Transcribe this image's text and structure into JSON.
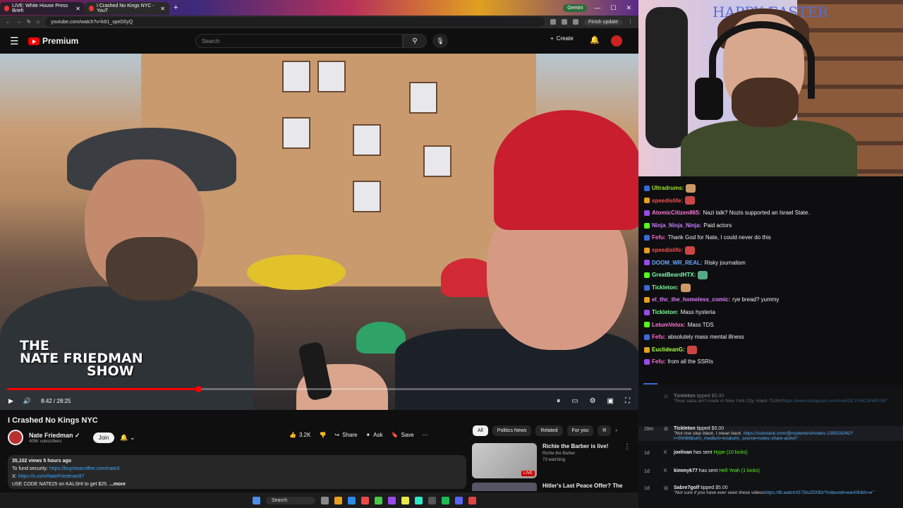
{
  "browser": {
    "tabs": [
      {
        "title": "LIVE: White House Press Briefi",
        "active": false
      },
      {
        "title": "I Crashed No Kings NYC - YouT",
        "active": true
      }
    ],
    "gemini_label": "Gemini",
    "url": "youtube.com/watch?v=k61_speD0yQ",
    "finish_update": "Finish update"
  },
  "youtube": {
    "brand": "Premium",
    "search_placeholder": "Search",
    "create_label": "Create"
  },
  "video": {
    "overlay_line1": "THE",
    "overlay_line2": "NATE FRIEDMAN",
    "overlay_line3": "SHOW",
    "time": "8:42 / 28:25",
    "progress": 0.306,
    "title": "I Crashed No Kings NYC",
    "channel": "Nate Friedman",
    "subscribers": "405K subscribers",
    "join_label": "Join",
    "likes": "3.2K",
    "share_label": "Share",
    "ask_label": "Ask",
    "save_label": "Save",
    "description": {
      "meta": "35,102 views  5 hours ago",
      "line1_prefix": "To fund security: ",
      "line1_link": "https://buymeacoffee.com/nate3",
      "line2_prefix": "X: ",
      "line2_link": "https://x.com/NateFriedman97",
      "line3": "USE CODE NATE25 on KALSHI to get $25. ",
      "more": "...more"
    }
  },
  "recommendations": {
    "chips": [
      "All",
      "Politics News",
      "Related",
      "For you",
      "R"
    ],
    "items": [
      {
        "title": "Richie the Barber is live!",
        "channel": "Richie the Barber",
        "meta": "73 watching",
        "badge": "LIVE"
      },
      {
        "title": "Hitler's Last Peace Offer? The"
      }
    ]
  },
  "taskbar": {
    "search": "Search"
  },
  "webcam": {
    "sign": "HAPPY EASTER"
  },
  "chat": [
    {
      "user": "Ultradrums:",
      "text": "",
      "color": "#a6e22e"
    },
    {
      "user": "speedislife:",
      "text": "",
      "color": "#ff4d4d"
    },
    {
      "user": "AtomicCitizen865:",
      "text": "Nazi talk? Nozis supported an Israel State.",
      "color": "#ff7ad9"
    },
    {
      "user": "Ninja_Ninja_Ninja:",
      "text": "Paid actors",
      "color": "#c77dff"
    },
    {
      "user": "Fefu:",
      "text": "Thank God for Nate, I could never do this",
      "color": "#ff6bd6"
    },
    {
      "user": "speedislife:",
      "text": "",
      "color": "#ff4d4d"
    },
    {
      "user": "DOOM_WR_REAL:",
      "text": "Risky journalism",
      "color": "#6fa8ff"
    },
    {
      "user": "GreatBeardHTX:",
      "text": "",
      "color": "#7cffb2"
    },
    {
      "user": "Tickleton:",
      "text": "",
      "color": "#7cff9a"
    },
    {
      "user": "el_thc_the_homeless_comic:",
      "text": "rye bread? yummy",
      "color": "#e07dff"
    },
    {
      "user": "Tickleton:",
      "text": "Mass hysteria",
      "color": "#7cff9a"
    },
    {
      "user": "LetumVelox:",
      "text": "Mass TDS",
      "color": "#ff7ad9"
    },
    {
      "user": "Fefu:",
      "text": "absolutely mass mental illness",
      "color": "#ff6bd6"
    },
    {
      "user": "EuclideanG:",
      "text": "",
      "color": "#a6ff4d"
    },
    {
      "user": "Fefu:",
      "text": "from all the SSRIs",
      "color": "#ff6bd6"
    }
  ],
  "events": [
    {
      "time": "",
      "who": "Tickleton",
      "action": " tipped ",
      "amount": "$5.00",
      "note": "Real salsa ain't made in New York City. Hawk TUAH!",
      "link": "https://www.instagram.com/reel/DCYSNCWWR1N/",
      "faded": true
    },
    {
      "time": "28m",
      "who": "Tickleton",
      "action": " tipped ",
      "amount": "$5.00",
      "note": "Not one step black. I mean back. ",
      "link": "https://substack.com/@roybentzvi/note/c-235519242?r=5hh66&utm_medium=ios&utm_source=notes-share-action"
    },
    {
      "time": "1d",
      "who": "joelivan",
      "action": " has sent ",
      "amount": "Hype (10 kicks)",
      "kick": true
    },
    {
      "time": "1d",
      "who": "kimmyk77",
      "action": " has sent ",
      "amount": "Hell Yeah (1 kicks)",
      "kick": true
    },
    {
      "time": "1d",
      "who": "Sabre7golf",
      "action": " tipped ",
      "amount": "$5.00",
      "note": "Not sure if you have ever seen these videos",
      "link": "https://fb.watch/G7StoZDf3D/?mibextid=wwXIfr&fs=e"
    }
  ]
}
